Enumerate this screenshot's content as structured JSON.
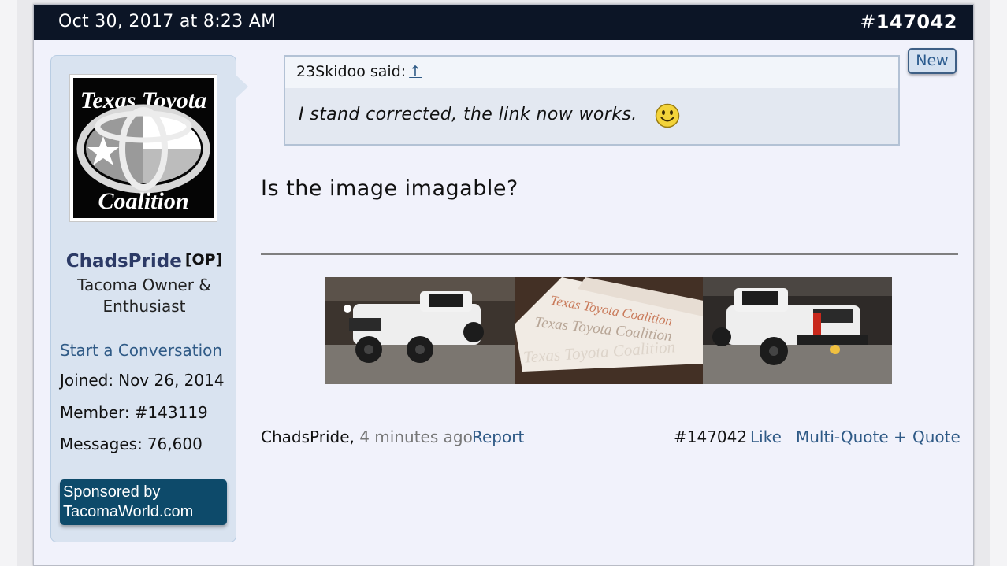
{
  "header": {
    "date": "Oct 30, 2017 at 8:23 AM",
    "post_number_hash": "#",
    "post_number": "147042"
  },
  "author": {
    "avatar_alt": "Texas Toyota Coalition",
    "avatar_text_top": "Texas Toyota",
    "avatar_text_bottom": "Coalition",
    "username": "ChadsPride",
    "op_tag": "[OP]",
    "title": "Tacoma Owner & Enthusiast",
    "start_conversation": "Start a Conversation",
    "joined_label": "Joined:",
    "joined_value": "Nov 26, 2014",
    "member_label": "Member:",
    "member_value": "#143119",
    "messages_label": "Messages:",
    "messages_value": "76,600",
    "sponsor_line1": "Sponsored by",
    "sponsor_line2": "TacomaWorld.com"
  },
  "new_badge": "New",
  "quote": {
    "author": "23Skidoo said:",
    "link_icon": "↑",
    "text": "I stand corrected, the link now works.",
    "emoji": "smiley-icon"
  },
  "message": {
    "text": "Is the image imagable?",
    "images": [
      "white-tacoma-front",
      "texas-toyota-coalition-decals",
      "white-tacoma-rear"
    ],
    "decal_text": "Texas Toyota Coalition"
  },
  "footer": {
    "author": "ChadsPride,",
    "time": "4 minutes ago",
    "report": "Report",
    "post_number": "#147042",
    "like": "Like",
    "multi_quote": "Multi-Quote +",
    "quote": "Quote"
  },
  "colors": {
    "header_bg": "#0c1526",
    "link": "#2f5a86",
    "username": "#2c3a66",
    "sponsor_bg": "#0d4a6a"
  }
}
